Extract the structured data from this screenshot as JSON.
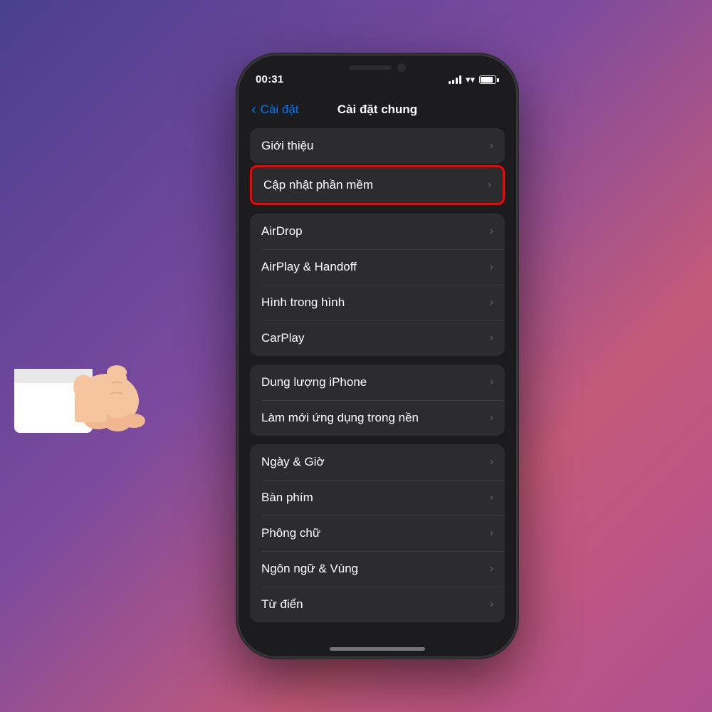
{
  "background": {
    "gradient_start": "#4a3f8f",
    "gradient_end": "#c45a7a"
  },
  "status_bar": {
    "time": "00:31",
    "signal_label": "signal",
    "wifi_label": "wifi",
    "battery_label": "battery"
  },
  "nav": {
    "back_label": "Cài đặt",
    "title": "Cài đặt chung"
  },
  "groups": [
    {
      "id": "group1",
      "items": [
        {
          "id": "gioithieu",
          "label": "Giới thiệu",
          "highlighted": false
        },
        {
          "id": "capnhat",
          "label": "Cập nhật phần mềm",
          "highlighted": true
        }
      ]
    },
    {
      "id": "group2",
      "items": [
        {
          "id": "airdrop",
          "label": "AirDrop",
          "highlighted": false
        },
        {
          "id": "airplay",
          "label": "AirPlay & Handoff",
          "highlighted": false
        },
        {
          "id": "hinhtronghinh",
          "label": "Hình trong hình",
          "highlighted": false
        },
        {
          "id": "carplay",
          "label": "CarPlay",
          "highlighted": false
        }
      ]
    },
    {
      "id": "group3",
      "items": [
        {
          "id": "dungiphone",
          "label": "Dung lượng iPhone",
          "highlighted": false
        },
        {
          "id": "lammoiungdung",
          "label": "Làm mới ứng dụng trong nền",
          "highlighted": false
        }
      ]
    },
    {
      "id": "group4",
      "items": [
        {
          "id": "ngaygio",
          "label": "Ngày & Giờ",
          "highlighted": false
        },
        {
          "id": "banphim",
          "label": "Bàn phím",
          "highlighted": false
        },
        {
          "id": "phongchu",
          "label": "Phông chữ",
          "highlighted": false
        },
        {
          "id": "ngonngu",
          "label": "Ngôn ngữ & Vùng",
          "highlighted": false
        },
        {
          "id": "tudien",
          "label": "Từ điển",
          "highlighted": false
        }
      ]
    }
  ],
  "home_indicator": "white bar"
}
